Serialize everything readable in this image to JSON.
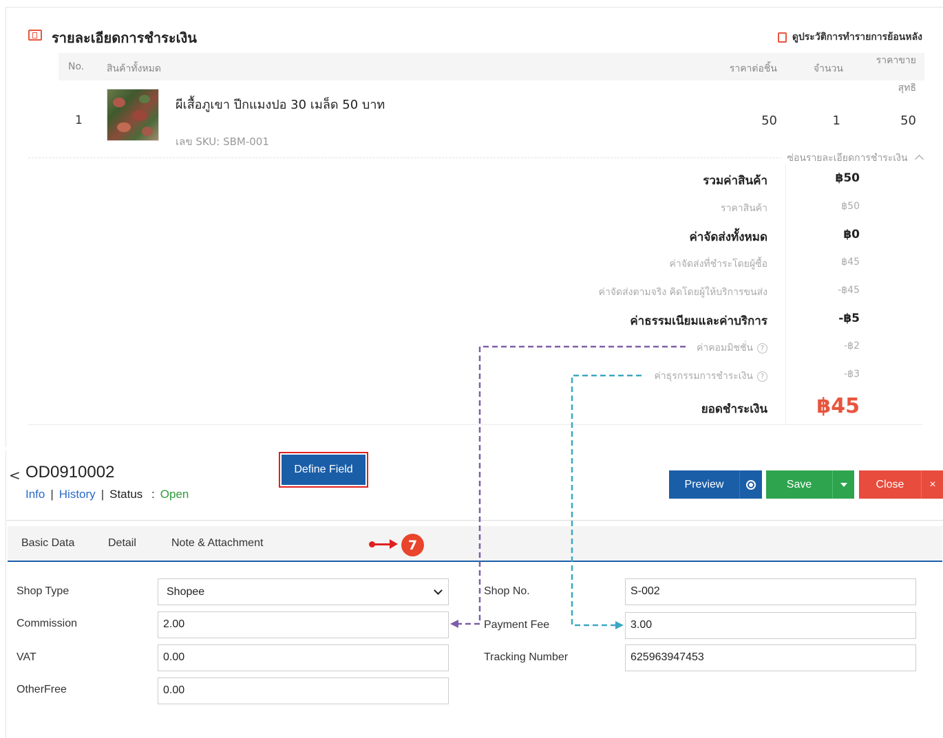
{
  "payment": {
    "title": "รายละเอียดการชำระเงิน",
    "history_link": "ดูประวัติการทำรายการย้อนหลัง",
    "columns": {
      "no": "No.",
      "product": "สินค้าทั้งหมด",
      "unit_price": "ราคาต่อชิ้น",
      "qty": "จำนวน",
      "net_line1": "ราคาขาย",
      "net_line2": "สุทธิ"
    },
    "item": {
      "no": "1",
      "name": "ผีเสื้อภูเขา ปีกแมงปอ 30 เมล็ด 50 บาท",
      "sku": "เลข SKU: SBM-001",
      "unit_price": "50",
      "qty": "1",
      "net": "50"
    },
    "hide_details": "ซ่อนรายละเอียดการชำระเงิน",
    "summary": {
      "subtotal_label": "รวมค่าสินค้า",
      "subtotal": "฿50",
      "product_price_label": "ราคาสินค้า",
      "product_price": "฿50",
      "shipping_total_label": "ค่าจัดส่งทั้งหมด",
      "shipping_total": "฿0",
      "shipping_buyer_label": "ค่าจัดส่งที่ชำระโดยผู้ซื้อ",
      "shipping_buyer": "฿45",
      "shipping_actual_label": "ค่าจัดส่งตามจริง คิดโดยผู้ให้บริการขนส่ง",
      "shipping_actual": "-฿45",
      "fees_label": "ค่าธรรมเนียมและค่าบริการ",
      "fees": "-฿5",
      "commission_label": "ค่าคอมมิชชั่น",
      "commission": "-฿2",
      "transaction_label": "ค่าธุรกรรมการชำระเงิน",
      "transaction": "-฿3",
      "total_label": "ยอดชำระเงิน",
      "total": "฿45"
    }
  },
  "order": {
    "number": "OD0910002",
    "links": {
      "info": "Info",
      "history": "History",
      "status_label": "Status",
      "colon": ":",
      "status": "Open"
    },
    "buttons": {
      "preview": "Preview",
      "save": "Save",
      "close": "Close",
      "x": "×"
    },
    "tabs": [
      "Basic Data",
      "Detail",
      "Note & Attachment",
      "Define Field"
    ],
    "step_badge": "7",
    "fields": {
      "shop_type_label": "Shop Type",
      "shop_type": "Shopee",
      "commission_label": "Commission",
      "commission": "2.00",
      "vat_label": "VAT",
      "vat": "0.00",
      "otherfree_label": "OtherFree",
      "otherfree": "0.00",
      "shop_no_label": "Shop No.",
      "shop_no": "S-002",
      "payment_fee_label": "Payment Fee",
      "payment_fee": "3.00",
      "tracking_label": "Tracking Number",
      "tracking": "625963947453"
    }
  },
  "colors": {
    "accent_blue": "#1a5ea8",
    "save_green": "#2ea44f",
    "close_red": "#e74c3c",
    "total_orange": "#e8553e",
    "purple_connector": "#7b5ea8",
    "teal_connector": "#3ba7c4"
  },
  "icons": [
    "receipt-icon",
    "history-doc-icon",
    "chevron-up-icon",
    "help-circle-icon",
    "chevron-left-icon",
    "eye-icon",
    "caret-down-icon",
    "close-x-icon",
    "select-chevron-icon"
  ]
}
